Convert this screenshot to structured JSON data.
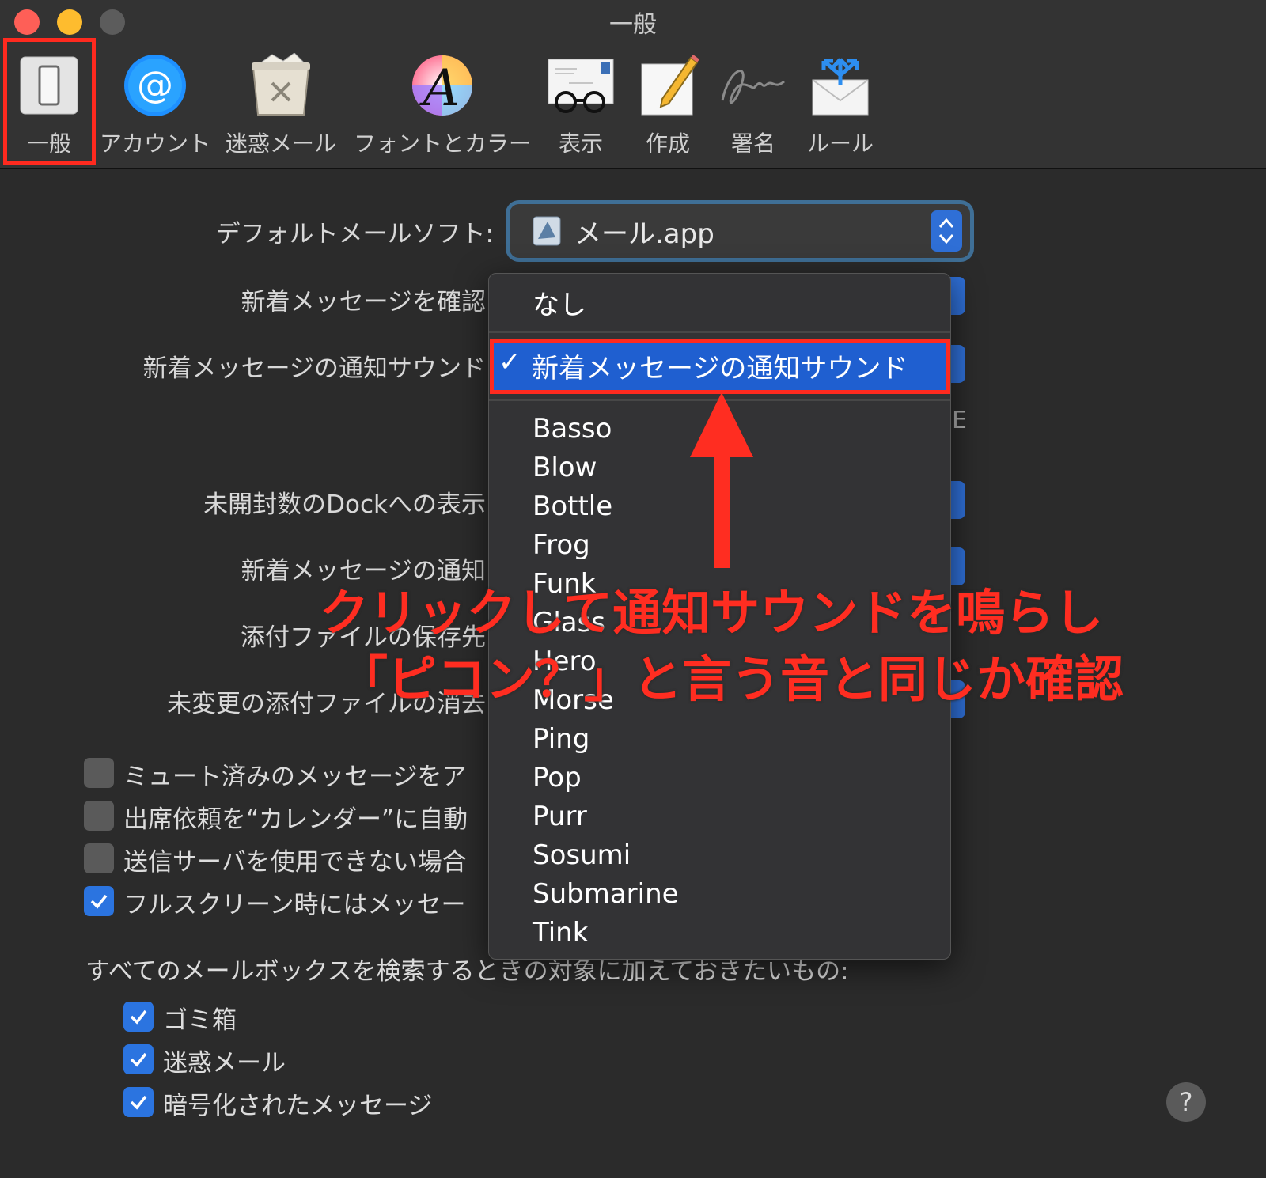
{
  "window": {
    "title": "一般",
    "traffic_colors": {
      "close": "#fe5f57",
      "minimize": "#febc2e",
      "zoom": "#5c5c5c"
    }
  },
  "toolbar": {
    "items": [
      {
        "label": "一般",
        "icon": "switch-icon"
      },
      {
        "label": "アカウント",
        "icon": "at-sign-icon"
      },
      {
        "label": "迷惑メール",
        "icon": "junk-bin-icon"
      },
      {
        "label": "フォントとカラー",
        "icon": "font-color-icon"
      },
      {
        "label": "表示",
        "icon": "glasses-envelope-icon"
      },
      {
        "label": "作成",
        "icon": "pencil-paper-icon"
      },
      {
        "label": "署名",
        "icon": "signature-icon"
      },
      {
        "label": "ルール",
        "icon": "rules-envelope-icon"
      }
    ],
    "selected": "一般"
  },
  "settings": {
    "default_app_label": "デフォルトメールソフト:",
    "default_app_value": "メール.app",
    "rows": [
      {
        "label": "新着メッセージを確認"
      },
      {
        "label": "新着メッセージの通知サウンド"
      },
      {
        "label": "未開封数のDockへの表示"
      },
      {
        "label": "新着メッセージの通知"
      },
      {
        "label": "添付ファイルの保存先"
      },
      {
        "label": "未変更の添付ファイルの消去"
      }
    ],
    "partial_right_text": "E",
    "checkboxes": [
      {
        "label": "ミュート済みのメッセージをア",
        "checked": false
      },
      {
        "label": "出席依頼を“カレンダー”に自動",
        "checked": false
      },
      {
        "label": "送信サーバを使用できない場合",
        "checked": false
      },
      {
        "label": "フルスクリーン時にはメッセー",
        "checked": true
      }
    ],
    "search_heading": "すべてのメールボックスを検索するときの対象に加えておきたいもの:",
    "search_options": [
      {
        "label": "ゴミ箱",
        "checked": true
      },
      {
        "label": "迷惑メール",
        "checked": true
      },
      {
        "label": "暗号化されたメッセージ",
        "checked": true
      }
    ]
  },
  "sound_menu": {
    "none_option": "なし",
    "selected_option": "新着メッセージの通知サウンド",
    "checkmark": "✓",
    "sounds": [
      "Basso",
      "Blow",
      "Bottle",
      "Frog",
      "Funk",
      "Glass",
      "Hero",
      "Morse",
      "Ping",
      "Pop",
      "Purr",
      "Sosumi",
      "Submarine",
      "Tink"
    ]
  },
  "annotation": {
    "line1": "クリックして通知サウンドを鳴らし",
    "line2": "「ピコン？」と言う音と同じか確認",
    "color": "#ff2d21"
  },
  "help_label": "?"
}
